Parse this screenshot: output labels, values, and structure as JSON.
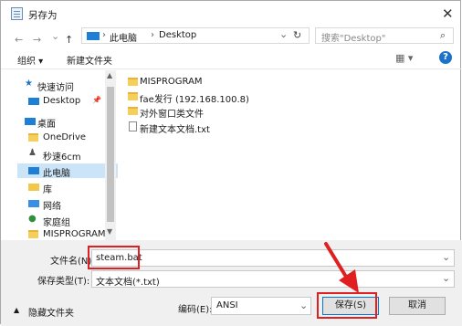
{
  "window": {
    "title": "另存为",
    "close_glyph": "✕"
  },
  "nav": {
    "back": "←",
    "forward": "→",
    "down": "⌄",
    "up": "↑"
  },
  "address": {
    "path": [
      "此电脑",
      "Desktop"
    ],
    "sep": "›",
    "refresh": "↻"
  },
  "search": {
    "placeholder": "搜索\"Desktop\"",
    "glyph": "⌕"
  },
  "toolbar": {
    "organize": "组织 ▾",
    "new_folder": "新建文件夹",
    "view_glyph": "▦ ▾",
    "help": "?"
  },
  "sidebar": {
    "items": [
      {
        "label": "快速访问",
        "icon": "star-icon"
      },
      {
        "label": "Desktop",
        "icon": "desktop-icon"
      },
      {
        "label": "桌面",
        "icon": "desktop-icon"
      },
      {
        "label": "OneDrive",
        "icon": "folder-icon"
      },
      {
        "label": "秒速6cm",
        "icon": "user-icon"
      },
      {
        "label": "此电脑",
        "icon": "computer-icon"
      },
      {
        "label": "库",
        "icon": "library-icon"
      },
      {
        "label": "网络",
        "icon": "network-icon"
      },
      {
        "label": "家庭组",
        "icon": "homegroup-icon"
      },
      {
        "label": "MISPROGRAM",
        "icon": "folder-icon"
      }
    ]
  },
  "files": [
    {
      "name": "MISPROGRAM",
      "type": "folder"
    },
    {
      "name": "fae发行 (192.168.100.8)",
      "type": "folder-shortcut"
    },
    {
      "name": "对外窗口类文件",
      "type": "folder-shortcut"
    },
    {
      "name": "新建文本文档.txt",
      "type": "txt"
    }
  ],
  "form": {
    "filename_label": "文件名(N):",
    "filename_value": "steam.bat",
    "filetype_label": "保存类型(T):",
    "filetype_value": "文本文档(*.txt)",
    "encoding_label": "编码(E):",
    "encoding_value": "ANSI",
    "hide_folders": "隐藏文件夹",
    "save": "保存(S)",
    "cancel": "取消",
    "chevron": "⌄"
  },
  "colors": {
    "highlight": "#e02020",
    "accent": "#1a73c9",
    "selected_bg": "#cce4f7"
  }
}
